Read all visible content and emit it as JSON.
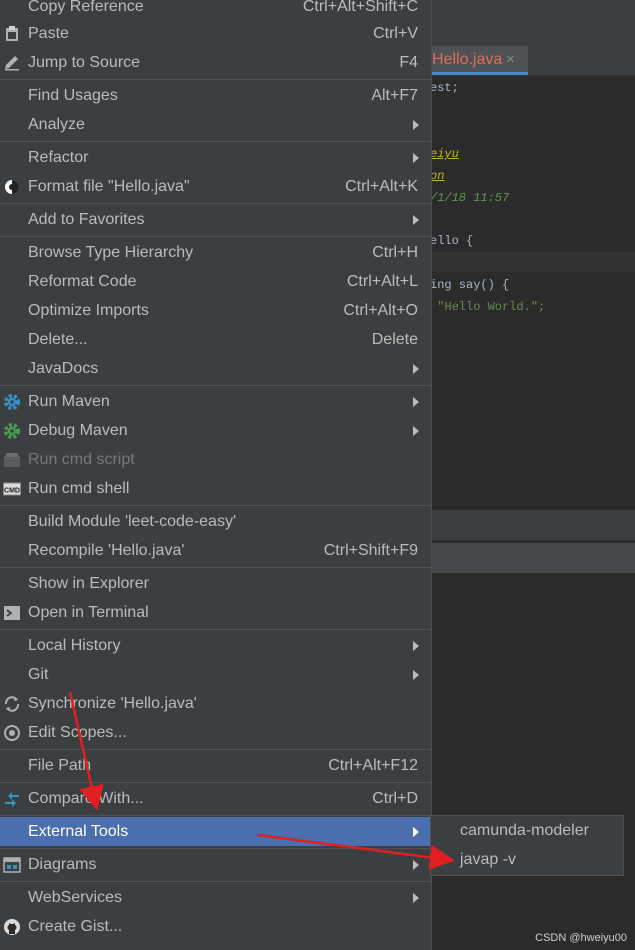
{
  "editor": {
    "tab_label": "Hello.java",
    "tab_close": "×",
    "code_lines": [
      {
        "text": "est;",
        "cls": ""
      },
      {
        "text": "eiyu",
        "cls": "c-yellow"
      },
      {
        "text": "on",
        "cls": "c-yellow"
      },
      {
        "text": "/1/18 11:57",
        "cls": "c-green"
      },
      {
        "text": "ello {",
        "cls": ""
      },
      {
        "text": "ing say() {",
        "cls": ""
      },
      {
        "text": " \"Hello World.\";",
        "cls": "c-str"
      }
    ],
    "watermark": "CSDN @hweiyu00"
  },
  "menu": {
    "items": [
      {
        "label": "Copy Reference",
        "shortcut": "Ctrl+Alt+Shift+C",
        "icon": ""
      },
      {
        "label": "Paste",
        "shortcut": "Ctrl+V",
        "icon": "paste-icon"
      },
      {
        "label": "Jump to Source",
        "shortcut": "F4",
        "icon": "pencil-icon"
      },
      {
        "label": "Find Usages",
        "shortcut": "Alt+F7",
        "icon": ""
      },
      {
        "label": "Analyze",
        "shortcut": "",
        "icon": "",
        "submenu": true
      },
      {
        "label": "Refactor",
        "shortcut": "",
        "icon": "",
        "submenu": true
      },
      {
        "label": "Format file \"Hello.java\"",
        "shortcut": "Ctrl+Alt+K",
        "icon": "format-icon"
      },
      {
        "label": "Add to Favorites",
        "shortcut": "",
        "icon": "",
        "submenu": true
      },
      {
        "label": "Browse Type Hierarchy",
        "shortcut": "Ctrl+H",
        "icon": ""
      },
      {
        "label": "Reformat Code",
        "shortcut": "Ctrl+Alt+L",
        "icon": ""
      },
      {
        "label": "Optimize Imports",
        "shortcut": "Ctrl+Alt+O",
        "icon": ""
      },
      {
        "label": "Delete...",
        "shortcut": "Delete",
        "icon": ""
      },
      {
        "label": "JavaDocs",
        "shortcut": "",
        "icon": "",
        "submenu": true
      },
      {
        "label": "Run Maven",
        "shortcut": "",
        "icon": "gear-blue-icon",
        "submenu": true
      },
      {
        "label": "Debug Maven",
        "shortcut": "",
        "icon": "gear-green-icon",
        "submenu": true
      },
      {
        "label": "Run cmd script",
        "shortcut": "",
        "icon": "cmd-script-icon",
        "disabled": true
      },
      {
        "label": "Run cmd shell",
        "shortcut": "",
        "icon": "cmd-icon"
      },
      {
        "label": "Build Module 'leet-code-easy'",
        "shortcut": "",
        "icon": ""
      },
      {
        "label": "Recompile 'Hello.java'",
        "shortcut": "Ctrl+Shift+F9",
        "icon": ""
      },
      {
        "label": "Show in Explorer",
        "shortcut": "",
        "icon": ""
      },
      {
        "label": "Open in Terminal",
        "shortcut": "",
        "icon": "terminal-icon"
      },
      {
        "label": "Local History",
        "shortcut": "",
        "icon": "",
        "submenu": true
      },
      {
        "label": "Git",
        "shortcut": "",
        "icon": "",
        "submenu": true
      },
      {
        "label": "Synchronize 'Hello.java'",
        "shortcut": "",
        "icon": "sync-icon"
      },
      {
        "label": "Edit Scopes...",
        "shortcut": "",
        "icon": "scope-icon"
      },
      {
        "label": "File Path",
        "shortcut": "Ctrl+Alt+F12",
        "icon": ""
      },
      {
        "label": "Compare With...",
        "shortcut": "Ctrl+D",
        "icon": "compare-icon"
      },
      {
        "label": "External Tools",
        "shortcut": "",
        "icon": "",
        "submenu": true,
        "selected": true
      },
      {
        "label": "Diagrams",
        "shortcut": "",
        "icon": "diagram-icon",
        "submenu": true
      },
      {
        "label": "WebServices",
        "shortcut": "",
        "icon": "",
        "submenu": true
      },
      {
        "label": "Create Gist...",
        "shortcut": "",
        "icon": "github-icon"
      }
    ]
  },
  "submenu": {
    "items": [
      {
        "label": "camunda-modeler"
      },
      {
        "label": "javap -v"
      }
    ]
  },
  "colors": {
    "menu_bg": "#3c3f41",
    "selection": "#4b6eaf",
    "annotation_arrow": "#e02020"
  }
}
